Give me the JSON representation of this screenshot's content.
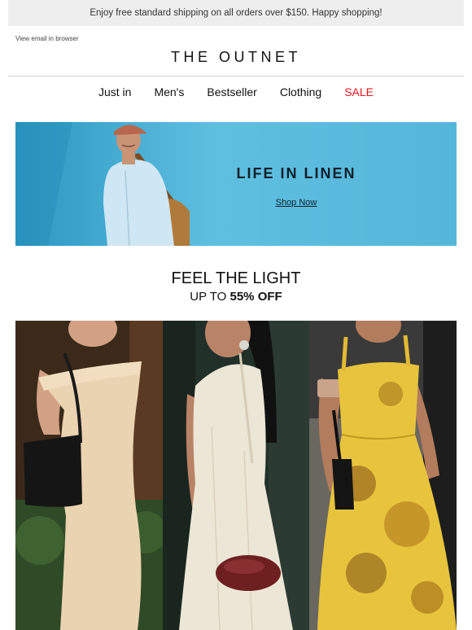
{
  "header": {
    "shipping_text": "Enjoy free standard shipping on all orders over $150. Happy shopping!",
    "view_in_browser": "View email in browser",
    "logo_text": "THE OUTNET"
  },
  "nav": {
    "items": [
      {
        "label": "Just in"
      },
      {
        "label": "Men's"
      },
      {
        "label": "Bestseller"
      },
      {
        "label": "Clothing"
      },
      {
        "label": "SALE"
      }
    ],
    "sale_color": "#e8141b"
  },
  "hero": {
    "title": "LIFE IN LINEN",
    "cta": "Shop Now",
    "background_color": "#4bb4d8"
  },
  "promo": {
    "title": "FEEL THE LIGHT",
    "subtitle_prefix": "UP TO ",
    "subtitle_emphasis": "55% OFF"
  },
  "gallery": {
    "tiles": [
      {
        "icon": "beige-dress-photo"
      },
      {
        "icon": "white-dress-photo"
      },
      {
        "icon": "yellow-floral-dress-photo"
      }
    ]
  }
}
